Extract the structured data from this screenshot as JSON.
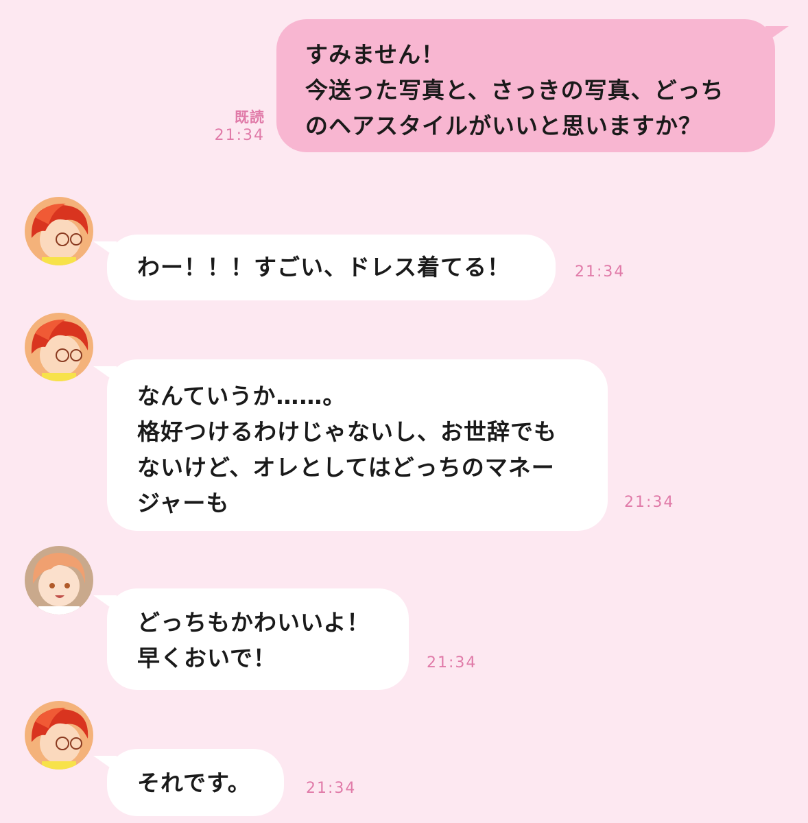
{
  "messages": [
    {
      "direction": "outgoing",
      "lines": [
        "すみません！",
        "今送った写真と、さっきの写真、どっち",
        "のヘアスタイルがいいと思いますか？"
      ],
      "read_label": "既読",
      "time": "21:34"
    },
    {
      "direction": "incoming",
      "avatar_icon": "red-haired-glasses-avatar-icon",
      "lines": [
        "わー！！！すごい、ドレス着てる！"
      ],
      "time": "21:34"
    },
    {
      "direction": "incoming",
      "avatar_icon": "red-haired-glasses-avatar-icon",
      "lines": [
        "なんていうか……。",
        "格好つけるわけじゃないし、お世辞でも",
        "ないけど、オレとしてはどっちのマネー",
        "ジャーも"
      ],
      "time": "21:34"
    },
    {
      "direction": "incoming",
      "avatar_icon": "orange-haired-smiling-avatar-icon",
      "lines": [
        "どっちもかわいいよ！",
        "早くおいで！"
      ],
      "time": "21:34"
    },
    {
      "direction": "incoming",
      "avatar_icon": "red-haired-glasses-avatar-icon",
      "lines": [
        "それです。"
      ],
      "time": "21:34"
    }
  ],
  "colors": {
    "background": "#fde8f1",
    "outgoing_bubble": "#f8b6d1",
    "incoming_bubble": "#ffffff",
    "meta_text": "#e07aa8"
  }
}
